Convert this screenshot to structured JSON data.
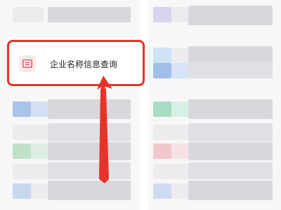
{
  "popup": {
    "menu_item": {
      "label": "企业名称信息查询",
      "icon": "document-list-icon"
    }
  },
  "annotation": {
    "color": "#e8332a",
    "arrow_direction": "up"
  }
}
